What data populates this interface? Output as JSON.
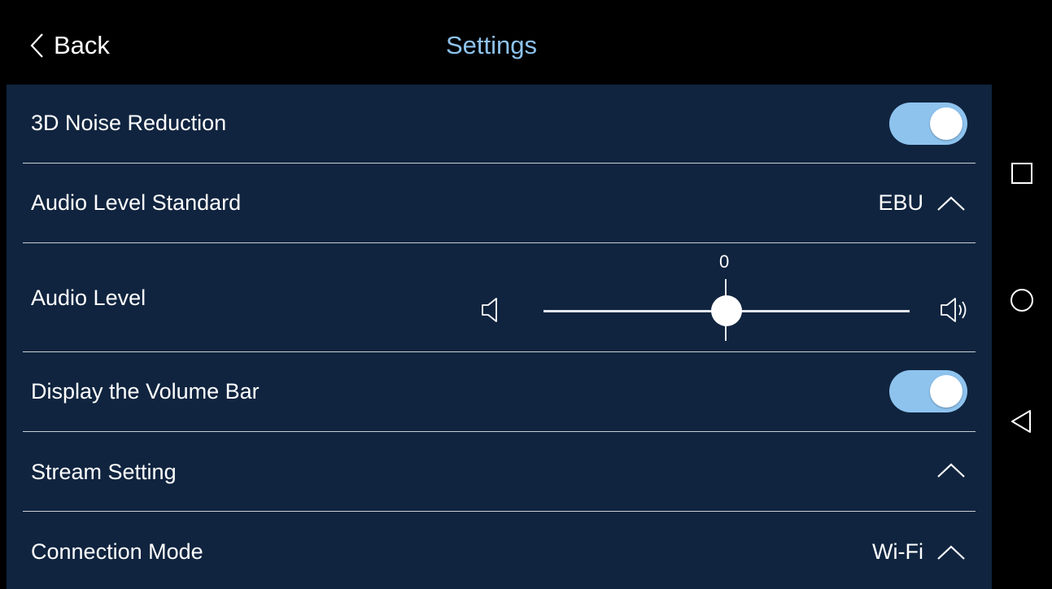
{
  "header": {
    "back_label": "Back",
    "title": "Settings"
  },
  "settings": {
    "noise_reduction": {
      "label": "3D Noise Reduction",
      "enabled": true
    },
    "audio_level_standard": {
      "label": "Audio Level Standard",
      "value": "EBU"
    },
    "audio_level": {
      "label": "Audio Level",
      "value": "0",
      "level_fraction": 0.5
    },
    "volume_bar": {
      "label": "Display the Volume Bar",
      "enabled": true
    },
    "stream_setting": {
      "label": "Stream Setting"
    },
    "connection_mode": {
      "label": "Connection Mode",
      "value": "Wi-Fi"
    }
  },
  "nav": {
    "recents": "square-icon",
    "home": "circle-icon",
    "back": "triangle-back-icon"
  },
  "colors": {
    "accent": "#8ec3ee",
    "panel": "#10243f",
    "topbar": "#000000"
  }
}
